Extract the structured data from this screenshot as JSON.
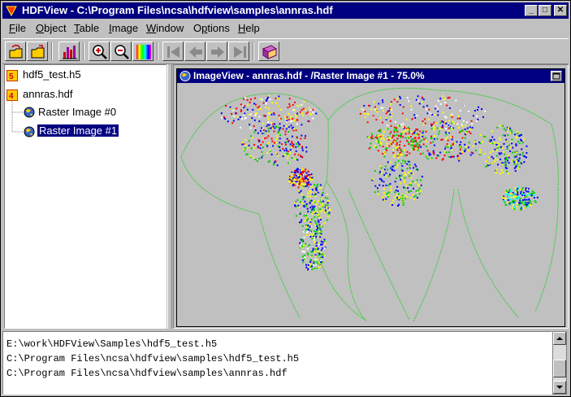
{
  "window": {
    "title": "HDFView - C:\\Program Files\\ncsa\\hdfview\\samples\\annras.hdf"
  },
  "menu": [
    {
      "label": "File",
      "key": "F",
      "rest": "ile"
    },
    {
      "label": "Object",
      "key": "O",
      "rest": "bject"
    },
    {
      "label": "Table",
      "key": "T",
      "rest": "able"
    },
    {
      "label": "Image",
      "key": "I",
      "rest": "mage"
    },
    {
      "label": "Window",
      "key": "W",
      "rest": "indow"
    },
    {
      "label": "Options",
      "key": "p",
      "rest": "tions",
      "prefix": "O"
    },
    {
      "label": "Help",
      "key": "H",
      "rest": "elp"
    }
  ],
  "toolbar": [
    "open-file-icon",
    "open-folder-icon",
    "histogram-icon",
    "zoom-in-icon",
    "zoom-out-icon",
    "palette-icon",
    "first-page-icon",
    "previous-page-icon",
    "next-page-icon",
    "last-page-icon",
    "help-book-icon"
  ],
  "tree": {
    "file1": "hdf5_test.h5",
    "file2": "annras.hdf",
    "image0": "Raster Image #0",
    "image1": "Raster Image #1"
  },
  "image_view": {
    "title": "ImageView - annras.hdf - /Raster Image #1 - 75.0%"
  },
  "log": {
    "lines": [
      "E:\\work\\HDFView\\Samples\\hdf5_test.h5",
      "C:\\Program Files\\ncsa\\hdfview\\samples\\hdf5_test.h5",
      "C:\\Program Files\\ncsa\\hdfview\\samples\\annras.hdf"
    ]
  },
  "colors": {
    "title_bar": "#000080",
    "window_bg": "#c0c0c0",
    "map_outline": "#33cc33"
  }
}
